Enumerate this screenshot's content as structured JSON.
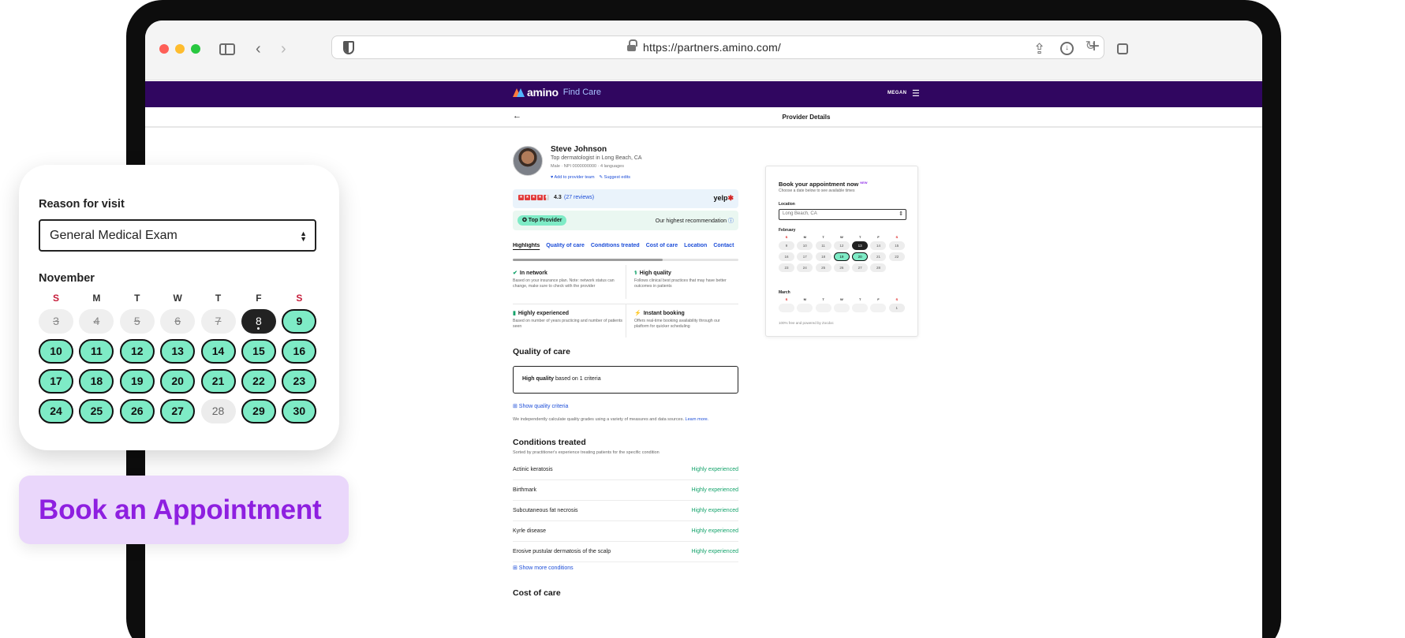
{
  "browser": {
    "url": "https://partners.amino.com/"
  },
  "header": {
    "logo": "amino",
    "find_care": "Find Care",
    "user": "MEGAN"
  },
  "subnav": {
    "back_glyph": "←",
    "title": "Provider Details"
  },
  "provider": {
    "name": "Steve Johnson",
    "specialty": "Top dermatologist in Long Beach, CA",
    "meta": "Male · NPI 0000000000 · 4 languages",
    "add_team": "♥ Add to provider team",
    "suggest_edits": "✎ Suggest edits",
    "rating": "4.3",
    "reviews": "(27 reviews)",
    "yelp": "yelp",
    "top_provider": "✪ Top Provider",
    "recommendation": "Our highest recommendation"
  },
  "tabs": [
    "Highlights",
    "Quality of care",
    "Conditions treated",
    "Cost of care",
    "Location",
    "Contact"
  ],
  "highlights": [
    {
      "icon": "✔",
      "title": "In network",
      "desc": "Based on your insurance plan. Note: network status can change, make sure to check with the provider"
    },
    {
      "icon": "⚕",
      "title": "High quality",
      "desc": "Follows clinical best practices that may have better outcomes in patients"
    },
    {
      "icon": "▮",
      "title": "Highly experienced",
      "desc": "Based on number of years practicing and number of patients seen"
    },
    {
      "icon": "⚡",
      "title": "Instant booking",
      "desc": "Offers real-time booking availability through our platform for quicker scheduling"
    }
  ],
  "quality": {
    "title": "Quality of care",
    "box_bold": "High quality",
    "box_rest": " based on 1 criteria",
    "show_link": "⊞ Show quality criteria",
    "fine_print": "We independently calculate quality grades using a variety of measures and data sources.",
    "learn_more": "Learn more."
  },
  "conditions": {
    "title": "Conditions treated",
    "subtitle": "Sorted by practitioner's experience treating patients for the specific condition",
    "rows": [
      {
        "name": "Actinic keratosis",
        "level": "Highly experienced"
      },
      {
        "name": "Birthmark",
        "level": "Highly experienced"
      },
      {
        "name": "Subcutaneous fat necrosis",
        "level": "Highly experienced"
      },
      {
        "name": "Kyrle disease",
        "level": "Highly experienced"
      },
      {
        "name": "Erosive pustular dermatosis of the scalp",
        "level": "Highly experienced"
      }
    ],
    "show_more": "⊞ Show more conditions"
  },
  "cost": {
    "title": "Cost of care"
  },
  "booking_widget": {
    "title": "Book your appointment now",
    "badge": "NEW",
    "subtitle": "Choose a date below to see available times",
    "location_label": "Location",
    "location_value": "Long Beach, CA",
    "month1": "February",
    "month2": "March",
    "dow": [
      "S",
      "M",
      "T",
      "W",
      "T",
      "F",
      "S"
    ],
    "feb_days": [
      {
        "d": "9",
        "s": "past"
      },
      {
        "d": "10",
        "s": "past"
      },
      {
        "d": "11",
        "s": "past"
      },
      {
        "d": "12",
        "s": "past"
      },
      {
        "d": "13",
        "s": "sel"
      },
      {
        "d": "14",
        "s": "past"
      },
      {
        "d": "15",
        "s": "past"
      },
      {
        "d": "16",
        "s": "past"
      },
      {
        "d": "17",
        "s": "past"
      },
      {
        "d": "18",
        "s": "past"
      },
      {
        "d": "19",
        "s": "avail"
      },
      {
        "d": "20",
        "s": "avail"
      },
      {
        "d": "21",
        "s": "past"
      },
      {
        "d": "22",
        "s": "past"
      },
      {
        "d": "23",
        "s": "past"
      },
      {
        "d": "24",
        "s": "past"
      },
      {
        "d": "25",
        "s": "past"
      },
      {
        "d": "26",
        "s": "past"
      },
      {
        "d": "27",
        "s": "past"
      },
      {
        "d": "28",
        "s": "past"
      },
      {
        "d": "",
        "s": "blank"
      }
    ],
    "mar_days": [
      {
        "d": "",
        "s": "empty"
      },
      {
        "d": "",
        "s": "empty"
      },
      {
        "d": "",
        "s": "empty"
      },
      {
        "d": "",
        "s": "empty"
      },
      {
        "d": "",
        "s": "empty"
      },
      {
        "d": "",
        "s": "empty"
      },
      {
        "d": "1",
        "s": "past"
      }
    ],
    "footer": "100% free and powered by Zocdoc"
  },
  "float_card": {
    "reason_label": "Reason for visit",
    "reason_value": "General Medical Exam",
    "month": "November",
    "dow": [
      "S",
      "M",
      "T",
      "W",
      "T",
      "F",
      "S"
    ],
    "days": [
      {
        "d": "3",
        "s": "past"
      },
      {
        "d": "4",
        "s": "past"
      },
      {
        "d": "5",
        "s": "past"
      },
      {
        "d": "6",
        "s": "past"
      },
      {
        "d": "7",
        "s": "past"
      },
      {
        "d": "8",
        "s": "today"
      },
      {
        "d": "9",
        "s": "avail"
      },
      {
        "d": "10",
        "s": "avail"
      },
      {
        "d": "11",
        "s": "avail"
      },
      {
        "d": "12",
        "s": "avail"
      },
      {
        "d": "13",
        "s": "avail"
      },
      {
        "d": "14",
        "s": "avail"
      },
      {
        "d": "15",
        "s": "avail"
      },
      {
        "d": "16",
        "s": "avail"
      },
      {
        "d": "17",
        "s": "avail"
      },
      {
        "d": "18",
        "s": "avail"
      },
      {
        "d": "19",
        "s": "avail"
      },
      {
        "d": "20",
        "s": "avail"
      },
      {
        "d": "21",
        "s": "avail"
      },
      {
        "d": "22",
        "s": "avail"
      },
      {
        "d": "23",
        "s": "avail"
      },
      {
        "d": "24",
        "s": "avail"
      },
      {
        "d": "25",
        "s": "avail"
      },
      {
        "d": "26",
        "s": "avail"
      },
      {
        "d": "27",
        "s": "avail"
      },
      {
        "d": "28",
        "s": "unavail"
      },
      {
        "d": "29",
        "s": "avail"
      },
      {
        "d": "30",
        "s": "avail"
      }
    ],
    "cta": "Book an Appointment"
  },
  "colors": {
    "nav_purple": "#300660",
    "available_green": "#7eebc6",
    "cta_bg": "#ead7fb",
    "cta_text": "#8e1fe0"
  }
}
